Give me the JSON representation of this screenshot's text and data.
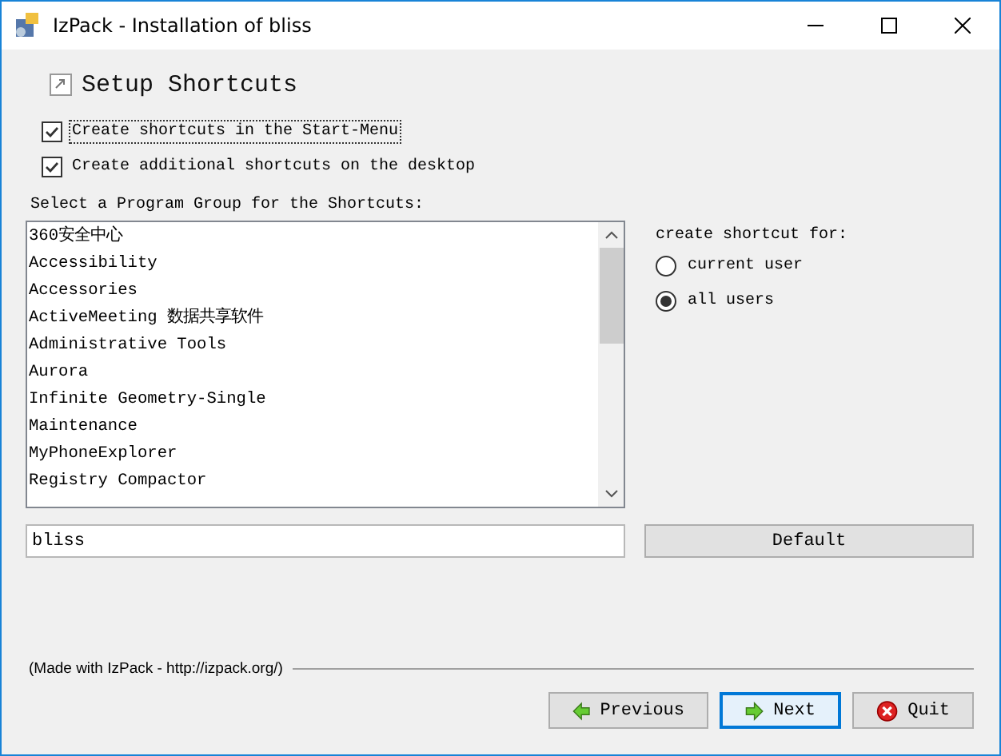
{
  "window": {
    "title": "IzPack - Installation of bliss"
  },
  "panel_title": "Setup Shortcuts",
  "options": [
    {
      "label": "Create shortcuts in the Start-Menu",
      "checked": true,
      "focused": true
    },
    {
      "label": "Create additional shortcuts on the desktop",
      "checked": true,
      "focused": false
    }
  ],
  "group_label": "Select a Program Group for the Shortcuts:",
  "program_groups": [
    {
      "label": "360安全中心"
    },
    {
      "label": "Accessibility"
    },
    {
      "label": "Accessories"
    },
    {
      "label": "ActiveMeeting 数据共享软件"
    },
    {
      "label": "Administrative Tools"
    },
    {
      "label": "Aurora"
    },
    {
      "label": "Infinite Geometry-Single"
    },
    {
      "label": "Maintenance"
    },
    {
      "label": "MyPhoneExplorer"
    },
    {
      "label": "Registry Compactor"
    }
  ],
  "target_label": "create shortcut for:",
  "targets": [
    {
      "label": "current user",
      "selected": false
    },
    {
      "label": "all users",
      "selected": true
    }
  ],
  "group_field": {
    "value": "bliss"
  },
  "default_button": "Default",
  "footer": "(Made with IzPack - http://izpack.org/)",
  "buttons": [
    {
      "kind": "previous",
      "label": "Previous",
      "focused": false
    },
    {
      "kind": "next",
      "label": "Next",
      "focused": true
    },
    {
      "kind": "quit",
      "label": "Quit",
      "focused": false
    }
  ]
}
